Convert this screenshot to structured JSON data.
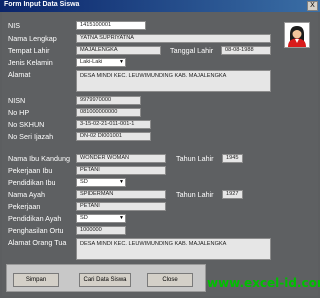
{
  "window": {
    "title": "Form Input Data Siswa",
    "close_glyph": "X"
  },
  "fields": {
    "nis": {
      "label": "NIS",
      "value": "1415100001"
    },
    "nama_lengkap": {
      "label": "Nama Lengkap",
      "value": "YATNA SUPRIYATNA"
    },
    "tempat_lahir": {
      "label": "Tempat Lahir",
      "value": "MAJALENGKA"
    },
    "tanggal_lahir": {
      "label": "Tanggal Lahir",
      "value": "08-08-1988"
    },
    "jenis_kelamin": {
      "label": "Jenis Kelamin",
      "value": "Laki-Laki"
    },
    "alamat": {
      "label": "Alamat",
      "value": "DESA MINDI KEC. LEUWIMUNDING KAB. MAJALENGKA"
    },
    "nisn": {
      "label": "NISN",
      "value": "9979970000"
    },
    "no_hp": {
      "label": "No HP",
      "value": "081000000000"
    },
    "no_skhun": {
      "label": "No SKHUN",
      "value": "3-15-02-21-011-001-1"
    },
    "no_seri_ijazah": {
      "label": "No Seri Ijazah",
      "value": "DN-02 DI001001"
    },
    "nama_ibu": {
      "label": "Nama Ibu Kandung",
      "value": "WONDER WOMAN"
    },
    "tahun_lahir_ibu": {
      "label": "Tahun Lahir",
      "value": "1945"
    },
    "pekerjaan_ibu": {
      "label": "Pekerjaan Ibu",
      "value": "PETANI"
    },
    "pendidikan_ibu": {
      "label": "Pendidikan Ibu",
      "value": "SD"
    },
    "nama_ayah": {
      "label": "Nama Ayah",
      "value": "SPIDERMAN"
    },
    "tahun_lahir_ayah": {
      "label": "Tahun Lahir",
      "value": "1927"
    },
    "pekerjaan_ayah": {
      "label": "Pekerjaan",
      "value": "PETANI"
    },
    "pendidikan_ayah": {
      "label": "Pendidikan Ayah",
      "value": "SD"
    },
    "penghasilan_ortu": {
      "label": "Penghasilan Ortu",
      "value": "1000000"
    },
    "alamat_ortu": {
      "label": "Alamat Orang Tua",
      "value": "DESA MINDI KEC. LEUWIMUNDING KAB. MAJALENGKA"
    }
  },
  "buttons": {
    "simpan": "Simpan",
    "cari": "Cari Data Siswa",
    "close": "Close"
  },
  "watermark": "www.excel-id.com",
  "colors": {
    "background": "#5e6062",
    "titlebar": "#0a246a",
    "watermark": "#00c000",
    "avatar_accent": "#d81b1b"
  },
  "icons": {
    "avatar": "student-avatar-icon"
  }
}
